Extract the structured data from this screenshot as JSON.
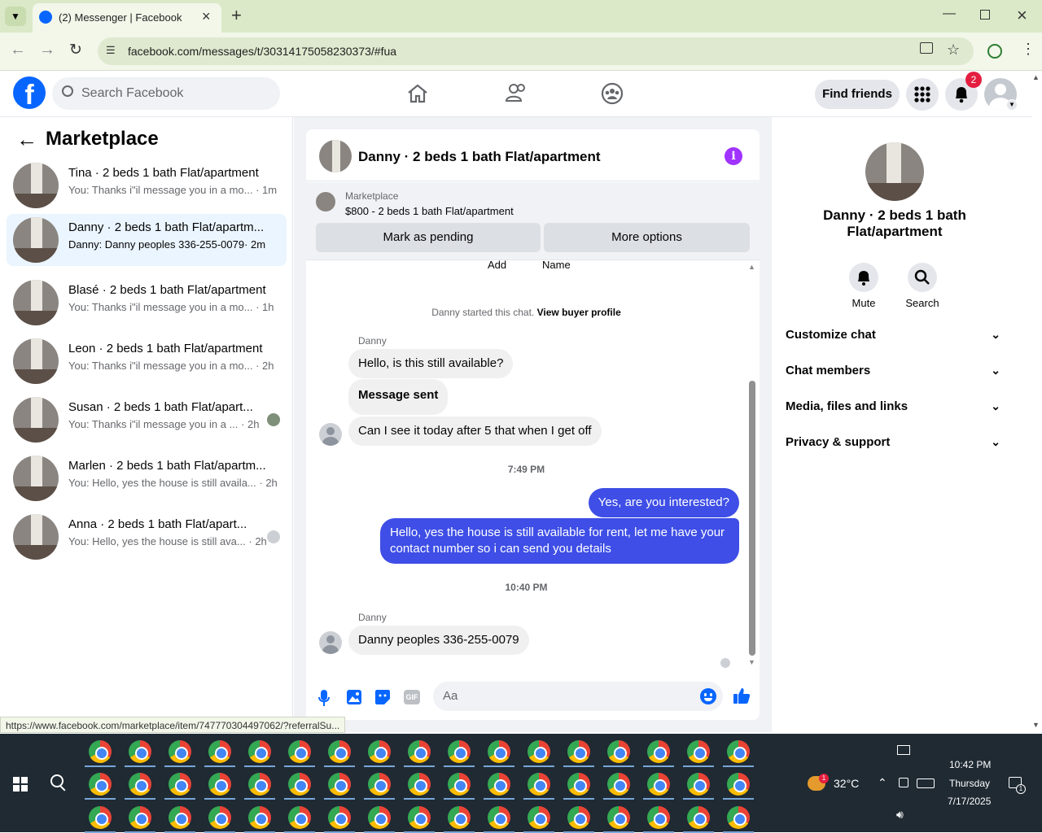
{
  "browser": {
    "tab_title": "(2) Messenger | Facebook",
    "url": "facebook.com/messages/t/30314175058230373/#fua",
    "status_url": "https://www.facebook.com/marketplace/item/747770304497062/?referralSu..."
  },
  "header": {
    "search_placeholder": "Search Facebook",
    "find_friends": "Find friends",
    "notification_count": "2"
  },
  "left": {
    "title": "Marketplace",
    "conversations": [
      {
        "title": "Tina · 2 beds 1 bath Flat/apartment",
        "preview": "You: Thanks i\"il message you in a mo...",
        "time": "· 1m"
      },
      {
        "title": "Danny · 2 beds 1 bath Flat/apartm...",
        "preview": "Danny: Danny peoples 336-255-0079",
        "time": "· 2m"
      },
      {
        "title": "Blasé · 2 beds 1 bath Flat/apartment",
        "preview": "You: Thanks i\"il message you in a mo...",
        "time": "· 1h"
      },
      {
        "title": "Leon · 2 beds 1 bath Flat/apartment",
        "preview": "You: Thanks i\"il message you in a mo...",
        "time": "· 2h"
      },
      {
        "title": "Susan · 2 beds 1 bath Flat/apart...",
        "preview": "You: Thanks i\"il message you in a ...",
        "time": "· 2h"
      },
      {
        "title": "Marlen · 2 beds 1 bath Flat/apartm...",
        "preview": "You: Hello, yes the house is still availa...",
        "time": "· 2h"
      },
      {
        "title": "Anna · 2 beds 1 bath Flat/apart...",
        "preview": "You: Hello, yes the house is still ava...",
        "time": "· 2h"
      }
    ]
  },
  "chat": {
    "title": "Danny · 2 beds 1 bath Flat/apartment",
    "listing_label": "Marketplace",
    "listing_text": "$800 - 2 beds 1 bath Flat/apartment",
    "mark_pending": "Mark as pending",
    "more_options": "More options",
    "partial_add": "Add",
    "partial_name": "Name",
    "started_text": "Danny started this chat.",
    "view_buyer": "View buyer profile",
    "sender_name": "Danny",
    "msg1": "Hello, is this still available?",
    "msg2": "Message sent",
    "msg3": "Can I see it today after 5 that when I get off",
    "time1": "7:49 PM",
    "msg4": "Yes, are you interested?",
    "msg5": "Hello, yes the house is still available for rent, let me have your contact number so i can send you details",
    "time2": "10:40 PM",
    "sender_name2": "Danny",
    "msg6": "Danny peoples 336-255-0079",
    "composer_placeholder": "Aa"
  },
  "right": {
    "name": "Danny · 2 beds 1 bath Flat/apartment",
    "mute": "Mute",
    "search": "Search",
    "sections": [
      "Customize chat",
      "Chat members",
      "Media, files and links",
      "Privacy & support"
    ]
  },
  "taskbar": {
    "temperature": "32°C",
    "time": "10:42 PM",
    "day": "Thursday",
    "date": "7/17/2025",
    "weather_badge": "1",
    "notif_badge": "1"
  },
  "colors": {
    "fb_blue": "#0866ff",
    "outgoing_bubble": "#3e4ee6",
    "info_purple": "#a033ff",
    "badge_red": "#e41e3f"
  }
}
